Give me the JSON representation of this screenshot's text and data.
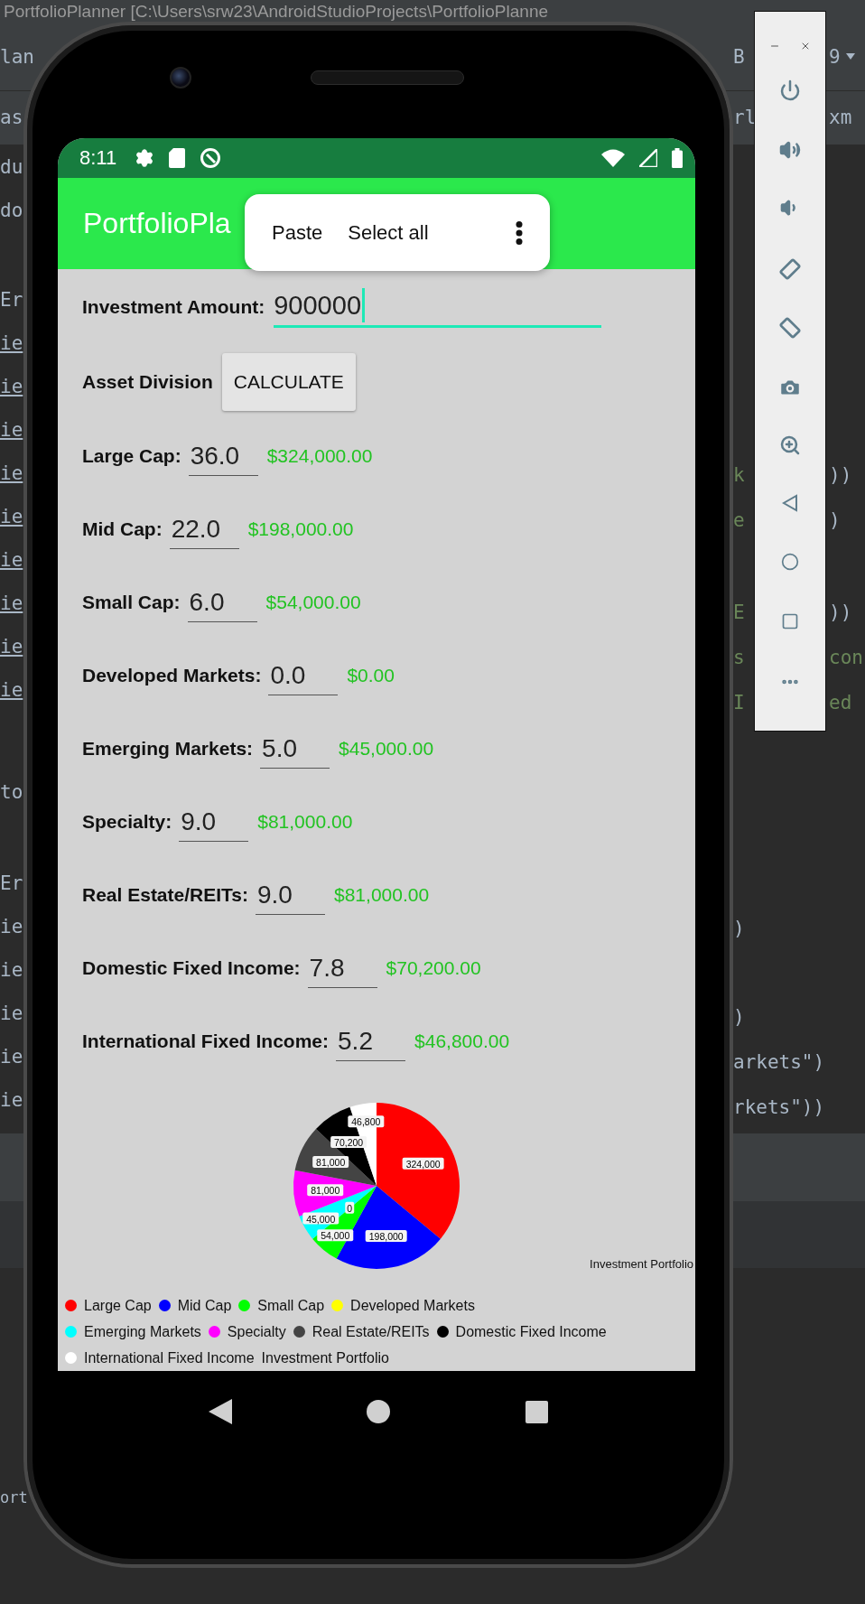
{
  "ide": {
    "title": "PortfolioPlanner [C:\\Users\\srw23\\AndroidStudioProjects\\PortfolioPlanne",
    "toolbar_row": {
      "left": "lan",
      "near": "B",
      "far": "9"
    },
    "tab_row": {
      "left": "as",
      "near": "rl",
      "far": "xm"
    },
    "left_blocks": [
      [
        {
          "text": "du",
          "underlined": false
        },
        {
          "text": "do",
          "underlined": false
        }
      ],
      [
        {
          "text": "Er",
          "underlined": false
        },
        {
          "text": "ie",
          "underlined": true
        },
        {
          "text": "ie",
          "underlined": true
        },
        {
          "text": "ie",
          "underlined": true
        },
        {
          "text": "ie",
          "underlined": true
        },
        {
          "text": "ie",
          "underlined": true
        },
        {
          "text": "ie",
          "underlined": true
        },
        {
          "text": "ie",
          "underlined": true
        },
        {
          "text": "ie",
          "underlined": true
        },
        {
          "text": "ie",
          "underlined": true
        }
      ],
      [
        {
          "text": "to",
          "underlined": false
        }
      ],
      [
        {
          "text": "Er",
          "underlined": false
        },
        {
          "text": "ie",
          "underlined": false
        },
        {
          "text": "ie",
          "underlined": false
        },
        {
          "text": "ie",
          "underlined": false
        },
        {
          "text": "ie",
          "underlined": false
        },
        {
          "text": "ie",
          "underlined": false
        }
      ],
      [
        {
          "text": "ort",
          "underlined": false
        }
      ]
    ],
    "right_blocks": [
      {
        "kind": "split",
        "lines": [
          {
            "near": {
              "text": "k",
              "color": "#6a8759"
            },
            "far": {
              "text": "))",
              "color": "#a9b7c6"
            }
          },
          {
            "near": {
              "text": "e",
              "color": "#6a8759"
            },
            "far": {
              "text": ")",
              "color": "#a9b7c6"
            }
          }
        ]
      },
      {
        "kind": "split",
        "lines": [
          {
            "near": {
              "text": "E",
              "color": "#6a8759"
            },
            "far": {
              "text": "))",
              "color": "#a9b7c6"
            }
          },
          {
            "near": {
              "text": "s",
              "color": "#6a8759"
            },
            "far": {
              "text": "con",
              "color": "#6a8759"
            }
          },
          {
            "near": {
              "text": "I",
              "color": "#6a8759"
            },
            "far": {
              "text": "ed",
              "color": "#6a8759"
            }
          }
        ]
      },
      {
        "kind": "full",
        "lines": [
          {
            "text": ")"
          }
        ]
      },
      {
        "kind": "full",
        "lines": [
          {
            "text": ")"
          },
          {
            "text": "arkets\")"
          },
          {
            "text": "rkets\"))"
          }
        ]
      }
    ]
  },
  "status_bar": {
    "time": "8:11"
  },
  "app_bar": {
    "title": "PortfolioPla"
  },
  "context_menu": {
    "items": [
      "Paste",
      "Select all"
    ]
  },
  "investment": {
    "label": "Investment Amount:",
    "value": "900000"
  },
  "asset_division": {
    "label": "Asset Division",
    "button": "CALCULATE"
  },
  "assets": [
    {
      "label": "Large Cap:",
      "percent": "36.0",
      "amount": "$324,000.00"
    },
    {
      "label": "Mid Cap:",
      "percent": "22.0",
      "amount": "$198,000.00"
    },
    {
      "label": "Small Cap:",
      "percent": "6.0",
      "amount": "$54,000.00"
    },
    {
      "label": "Developed Markets:",
      "percent": "0.0",
      "amount": "$0.00"
    },
    {
      "label": "Emerging Markets:",
      "percent": "5.0",
      "amount": "$45,000.00"
    },
    {
      "label": "Specialty:",
      "percent": "9.0",
      "amount": "$81,000.00"
    },
    {
      "label": "Real Estate/REITs:",
      "percent": "9.0",
      "amount": "$81,000.00"
    },
    {
      "label": "Domestic Fixed Income:",
      "percent": "7.8",
      "amount": "$70,200.00"
    },
    {
      "label": "International Fixed Income:",
      "percent": "5.2",
      "amount": "$46,800.00"
    }
  ],
  "chart": {
    "chart_data": {
      "type": "pie",
      "title": "Investment Portfolio",
      "categories": [
        "Large Cap",
        "Mid Cap",
        "Small Cap",
        "Developed Markets",
        "Emerging Markets",
        "Specialty",
        "Real Estate/REITs",
        "Domestic Fixed Income",
        "International Fixed Income"
      ],
      "series": [
        {
          "name": "Investment Portfolio",
          "values": [
            36,
            22,
            6,
            0,
            5,
            9,
            9,
            7.8,
            5.2
          ]
        }
      ],
      "colors": [
        "#ff0000",
        "#0000ff",
        "#00ff00",
        "#ffff00",
        "#00ffff",
        "#ff00ff",
        "#444444",
        "#000000",
        "#ffffff"
      ],
      "value_labels": [
        "324,000",
        "198,000",
        "54,000",
        "0",
        "45,000",
        "81,000",
        "81,000",
        "70,200",
        "46,800"
      ]
    }
  }
}
